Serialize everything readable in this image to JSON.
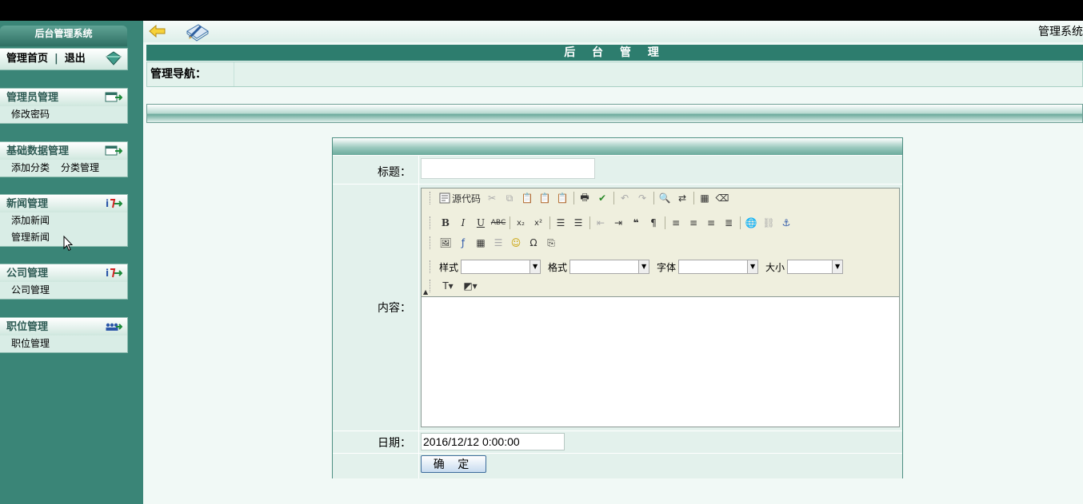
{
  "sidebar": {
    "title": "后台管理系统",
    "home": {
      "home_label": "管理首页",
      "separator": "|",
      "logout_label": "退出"
    },
    "sections": [
      {
        "title": "管理员管理",
        "items": [
          "修改密码"
        ]
      },
      {
        "title": "基础数据管理",
        "items": [
          "添加分类",
          "分类管理"
        ]
      },
      {
        "title": "新闻管理",
        "items": [
          "添加新闻",
          "管理新闻"
        ]
      },
      {
        "title": "公司管理",
        "items": [
          "公司管理"
        ]
      },
      {
        "title": "职位管理",
        "items": [
          "职位管理"
        ]
      }
    ]
  },
  "header": {
    "system_title": "管理系统",
    "admin_title": "后 台 管 理",
    "nav_label": "管理导航："
  },
  "form": {
    "title_label": "标题：",
    "title_value": "",
    "content_label": "内容：",
    "date_label": "日期：",
    "date_value": "2016/12/12 0:00:00",
    "submit_label": "确  定"
  },
  "editor": {
    "source_label": "源代码",
    "style_label": "样式",
    "format_label": "格式",
    "font_label": "字体",
    "size_label": "大小",
    "content": ""
  },
  "colors": {
    "sidebar_bg": "#3a8577",
    "header_bg": "#2d7d6e",
    "panel_bg": "#e3f1ec"
  }
}
